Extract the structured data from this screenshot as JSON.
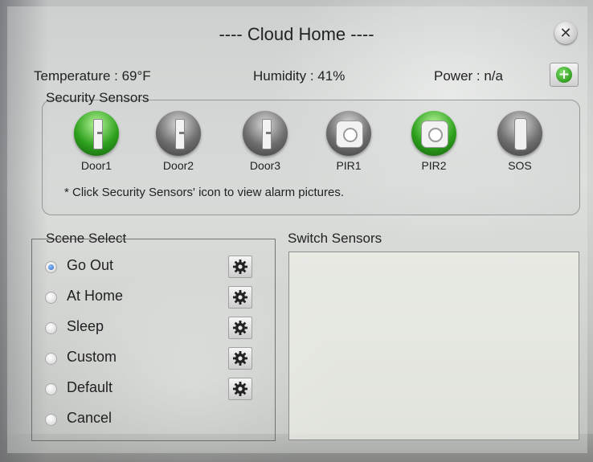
{
  "title": "---- Cloud Home ----",
  "status": {
    "temperature": "Temperature : 69°F",
    "humidity": "Humidity : 41%",
    "power": "Power : n/a"
  },
  "security": {
    "legend": "Security Sensors",
    "sensors": [
      {
        "label": "Door1",
        "kind": "door",
        "state": "active",
        "color": "#2ea11e"
      },
      {
        "label": "Door2",
        "kind": "door",
        "state": "inactive",
        "color": "#6e6e6e"
      },
      {
        "label": "Door3",
        "kind": "door",
        "state": "inactive",
        "color": "#6e6e6e"
      },
      {
        "label": "PIR1",
        "kind": "pir",
        "state": "inactive",
        "color": "#6e6e6e"
      },
      {
        "label": "PIR2",
        "kind": "pir",
        "state": "active",
        "color": "#2ea11e"
      },
      {
        "label": "SOS",
        "kind": "sos",
        "state": "inactive",
        "color": "#6e6e6e"
      }
    ],
    "hint": "* Click Security Sensors' icon to view alarm pictures."
  },
  "scene": {
    "legend": "Scene Select",
    "items": [
      {
        "label": "Go Out",
        "checked": true,
        "has_settings": true
      },
      {
        "label": "At Home",
        "checked": false,
        "has_settings": true
      },
      {
        "label": "Sleep",
        "checked": false,
        "has_settings": true
      },
      {
        "label": "Custom",
        "checked": false,
        "has_settings": true
      },
      {
        "label": "Default",
        "checked": false,
        "has_settings": true
      },
      {
        "label": "Cancel",
        "checked": false,
        "has_settings": false
      }
    ]
  },
  "switch_sensors": {
    "title": "Switch Sensors"
  },
  "icons": {
    "close": "close-icon",
    "add": "plus-icon",
    "settings": "gear-icon"
  }
}
